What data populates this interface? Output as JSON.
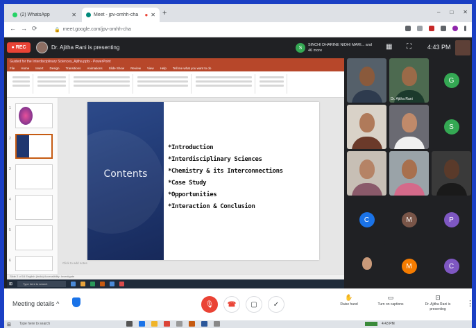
{
  "browser": {
    "tabs": [
      {
        "label": "(2) WhatsApp",
        "favicon_color": "#25d366"
      },
      {
        "label": "Meet - jpv-omhh-cha",
        "favicon_color": "#00897b"
      }
    ],
    "new_tab": "+",
    "window_controls": [
      "–",
      "□",
      "✕"
    ],
    "url": "meet.google.com/jpv-omhh-cha"
  },
  "meet_top": {
    "recording_label": "REC",
    "presenter_text": "Dr. Ajitha Rani is presenting",
    "pill_initial": "S",
    "pill_text": "SINCHI DHARINE NIDHI MARI... and 46 more",
    "clock": "4:43 PM"
  },
  "powerpoint": {
    "title": "Guided for the Interdisciplinary Sciences_Ajitha.pptx - PowerPoint",
    "menu": [
      "File",
      "Home",
      "Insert",
      "Design",
      "Transitions",
      "Animations",
      "Slide Show",
      "Review",
      "View",
      "Help",
      "Tell me what you want to do"
    ],
    "notes_hint": "Click to add notes",
    "status": "Slide 2 of 16    English (India)    Accessibility: Investigate",
    "thumb_numbers": [
      "1",
      "2",
      "3",
      "4",
      "5",
      "6"
    ],
    "taskbar_search": "Type here to search"
  },
  "slide": {
    "title": "Contents",
    "items": [
      "*Introduction",
      "*Interdisciplinary Sciences",
      "*Chemistry & its Interconnections",
      "*Case Study",
      "*Opportunities",
      "*Interaction & Conclusion"
    ]
  },
  "participants": {
    "tiles": [
      {
        "kind": "video",
        "skin": "#8a5a3c",
        "cloth": "#2e3b4e",
        "bg": "#55606a"
      },
      {
        "kind": "video",
        "skin": "#9b6a48",
        "cloth": "#1c3a2c",
        "bg": "#4d6a50",
        "name": "Dr. Ajitha Rani"
      },
      {
        "kind": "avatar",
        "initial": "G",
        "color": "#34a853"
      },
      {
        "kind": "video",
        "skin": "#b07a5a",
        "cloth": "#6b3a2a",
        "bg": "#d9d2c8"
      },
      {
        "kind": "video",
        "skin": "#c08a6a",
        "cloth": "#f0f0f0",
        "bg": "#6a6a72"
      },
      {
        "kind": "avatar",
        "initial": "S",
        "color": "#34a853"
      },
      {
        "kind": "video",
        "skin": "#b58366",
        "cloth": "#8a5a6a",
        "bg": "#c7bfb5"
      },
      {
        "kind": "video",
        "skin": "#a8704e",
        "cloth": "#d46a8a",
        "bg": "#9aa3a8"
      },
      {
        "kind": "video",
        "skin": "#5a3a2a",
        "cloth": "#1a1a1a",
        "bg": "#3a3a3a"
      },
      {
        "kind": "avatar",
        "initial": "C",
        "color": "#1a73e8"
      },
      {
        "kind": "avatar",
        "initial": "M",
        "color": "#795548"
      },
      {
        "kind": "avatar",
        "initial": "P",
        "color": "#7e57c2"
      },
      {
        "kind": "video",
        "skin": "#c99a7a",
        "cloth": "#202124",
        "bg": "#202124",
        "small": true
      },
      {
        "kind": "avatar",
        "initial": "M",
        "color": "#f57c00"
      },
      {
        "kind": "avatar",
        "initial": "C",
        "color": "#7e57c2"
      }
    ]
  },
  "meet_bottom": {
    "meeting_details": "Meeting details",
    "raise_hand": "Raise hand",
    "captions": "Turn on captions",
    "presenting_label": "Dr. Ajitha Rani is presenting",
    "more": "⋮"
  },
  "windows_taskbar": {
    "search": "Type here to search",
    "tray_time": "4:43 PM"
  }
}
